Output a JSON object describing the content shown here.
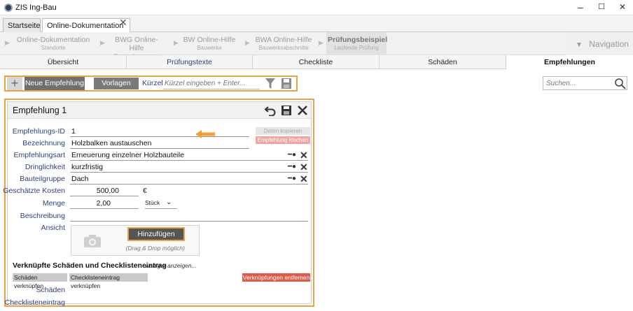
{
  "window": {
    "title": "ZIS Ing-Bau",
    "minimize": "–",
    "maximize": "☐",
    "close": "✕"
  },
  "tabs": [
    {
      "label": "Startseite"
    },
    {
      "label": "Online-Dokumentation",
      "close": "✕"
    }
  ],
  "breadcrumb": [
    {
      "label": "Online-Dokumentation",
      "sub": "Standorte"
    },
    {
      "label": "BWG Online-Hilfe",
      "sub": "Bauwerksgruppen"
    },
    {
      "label": "BW Online-Hilfe",
      "sub": "Bauwerke"
    },
    {
      "label": "BWA Online-Hilfe",
      "sub": "Bauwerksabschnitte"
    },
    {
      "label": "Prüfungsbeispiel",
      "sub": "Laufende Prüfung"
    }
  ],
  "navigation": {
    "label": "Navigation",
    "icon": "triangle-down-icon"
  },
  "section_tabs": [
    "Übersicht",
    "Prüfungstexte",
    "Checkliste",
    "Schäden",
    "Empfehlungen"
  ],
  "toolbar": {
    "add": "+",
    "neue_label": "Neue Empfehlung",
    "vorlagen_label": "Vorlagen",
    "kurzel_label": "Kürzel",
    "kurzel_placeholder": "Kürzel eingeben + Enter..."
  },
  "search": {
    "placeholder": "Suchen..."
  },
  "panel": {
    "title": "Empfehlung 1",
    "btn_kopieren": "Daten kopieren",
    "btn_loeschen": "Empfehlung löschen",
    "fields": {
      "id_label": "Empfehlungs-ID",
      "id_value": "1",
      "bez_label": "Bezeichnung",
      "bez_value": "Holzbalken austauschen",
      "art_label": "Empfehlungsart",
      "art_value": "Erneuerung einzelner Holzbauteile",
      "dring_label": "Dringlichkeit",
      "dring_value": "kurzfristig",
      "bg_label": "Bauteilgruppe",
      "bg_value": "Dach",
      "kosten_label": "Geschätzte Kosten",
      "kosten_value": "500,00",
      "kosten_unit": "€",
      "menge_label": "Menge",
      "menge_value": "2,00",
      "menge_unit": "Stück",
      "beschr_label": "Beschreibung",
      "ansicht_label": "Ansicht"
    },
    "ansicht": {
      "button": "Hinzufügen",
      "hint": "(Drag & Drop möglich)"
    },
    "verknuepft": {
      "title": "Verknüpfte Schäden und Checklisteneintrag",
      "more": "weniger anzeigen...",
      "btn_schaeden": "Schäden verknüpfen",
      "btn_checkliste": "Checklisteneintrag verknüpfen",
      "btn_entfernen": "Verknüpfungen entfernen",
      "schaeden_label": "Schäden",
      "checkliste_label": "Checklisteneintrag"
    }
  }
}
